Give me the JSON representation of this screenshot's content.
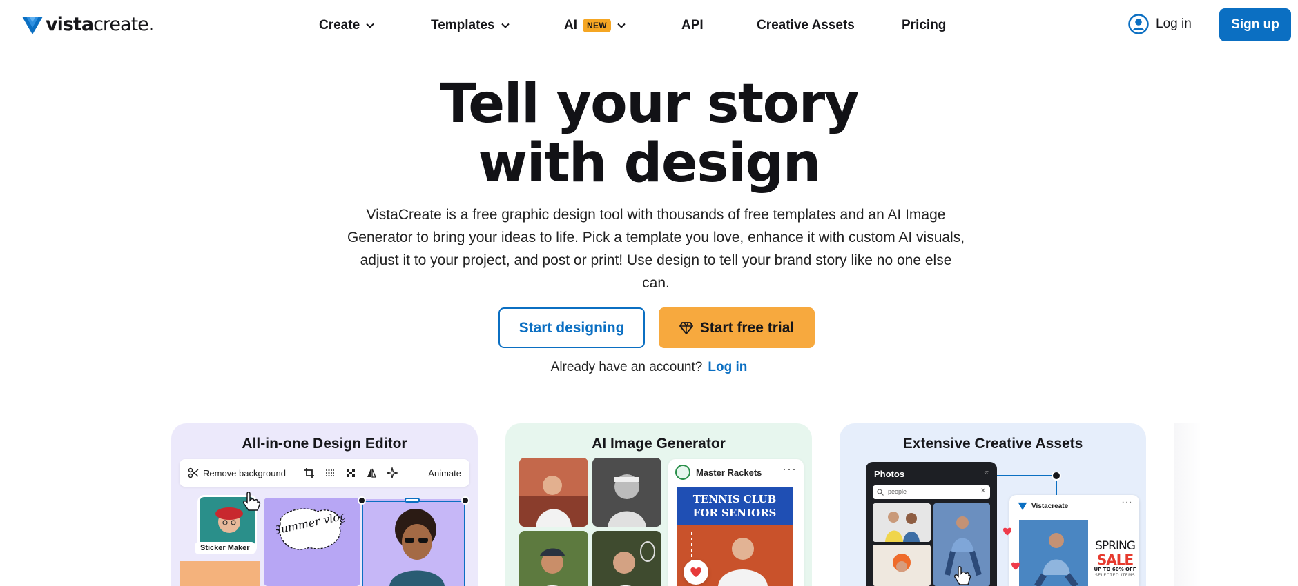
{
  "brand": {
    "name_bold": "vista",
    "name_light": "create",
    "dot": "."
  },
  "nav": {
    "create": "Create",
    "templates": "Templates",
    "ai": "AI",
    "ai_badge": "NEW",
    "api": "API",
    "creative_assets": "Creative Assets",
    "pricing": "Pricing"
  },
  "auth": {
    "login": "Log in",
    "signup": "Sign up"
  },
  "hero": {
    "title_line1": "Tell your story",
    "title_line2": "with design",
    "description": "VistaCreate is a free graphic design tool with thousands of free templates and an AI Image Generator to bring your ideas to life. Pick a template you love, enhance it with custom AI visuals, adjust it to your project, and post or print! Use design to tell your brand story like no one else can.",
    "cta_primary": "Start designing",
    "cta_trial": "Start free trial",
    "account_prompt": "Already have an account?",
    "account_login": "Log in"
  },
  "cards": [
    {
      "title": "All-in-one Design Editor",
      "toolbar": {
        "remove_bg": "Remove background",
        "animate": "Animate"
      },
      "sticker_label": "Sticker Maker",
      "vlog_text": "Summer vlog"
    },
    {
      "title": "AI Image Generator",
      "post_account": "Master Rackets",
      "poster_title_1": "TENNIS CLUB",
      "poster_title_2": "FOR SENIORS"
    },
    {
      "title": "Extensive Creative Assets",
      "panel_title": "Photos",
      "search_value": "people",
      "card_account": "Vistacreate",
      "promo_1": "SPRING",
      "promo_2": "SALE",
      "promo_3": "UP TO 60% OFF",
      "promo_4": "SELECTED ITEMS"
    }
  ],
  "colors": {
    "brand_blue": "#0b6fc2",
    "cta_orange": "#f7a93e",
    "badge_orange": "#f5a623"
  }
}
